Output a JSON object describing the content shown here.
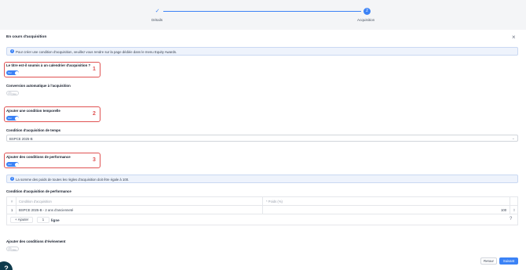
{
  "stepper": {
    "step1_label": "Détails",
    "step1_icon": "check-icon",
    "step2_label": "Acquisition",
    "step2_number": "2"
  },
  "panel": {
    "title": "En cours d'acquisition",
    "close_icon": "close-icon"
  },
  "info_top": "Pour créer une condition d'acquisition, veuillez vous rendre sur la page dédiée dans le menu Equity Awards.",
  "q1": {
    "label": "Le titre est-il soumis à un calendrier d'acquisition ?",
    "state": "Oui",
    "annotation": "1"
  },
  "q2": {
    "label": "Conversion automatique à l'acquisition",
    "state": "Non"
  },
  "q3": {
    "label": "Ajouter une condition temporelle",
    "state": "Oui",
    "annotation": "2"
  },
  "time_condition": {
    "label": "Condition d'acquisition de temps",
    "value": "BSPCE 2025-B"
  },
  "q4": {
    "label": "Ajouter des conditions de performance",
    "state": "Oui",
    "annotation": "3"
  },
  "info_weights": "La somme des poids de toutes les règles d'acquisition doit être égale à 100.",
  "perf": {
    "label": "Condition d'acquisition de performance",
    "columns": [
      "#",
      "Condition d'acquisition",
      "* Poids (%)"
    ],
    "rows": [
      {
        "index": "1",
        "condition": "BSPCE 2025-B - 2 ans d'ancienneté",
        "weight": "100"
      }
    ],
    "add_label": "Ajouter",
    "count": "1",
    "ligne_label": "ligne",
    "help": "?"
  },
  "q5": {
    "label": "Ajouter des conditions d'événement",
    "state": "Non"
  },
  "footer": {
    "back_label": "Retour",
    "next_label": "Suivant"
  },
  "help_bubble": "?",
  "colors": {
    "accent": "#3b82f6",
    "highlight": "#e05252",
    "help_bubble": "#0f3b4c"
  }
}
